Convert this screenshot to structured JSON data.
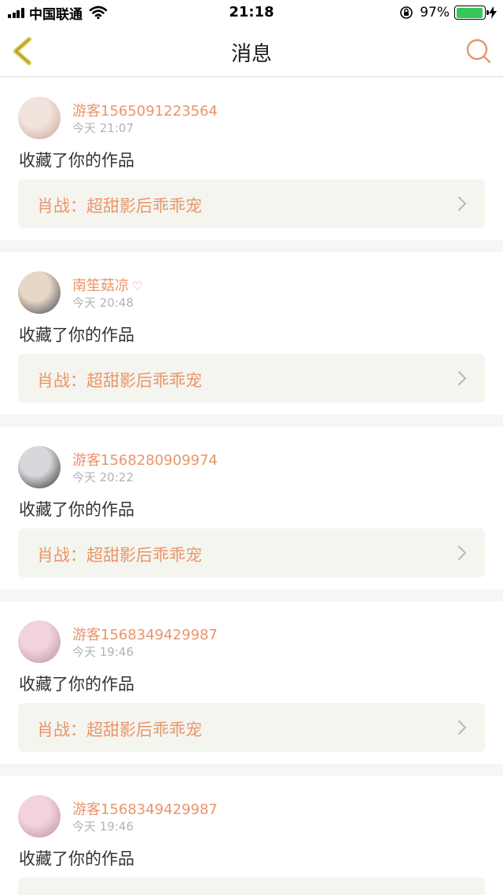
{
  "status_bar": {
    "carrier": "中国联通",
    "time": "21:18",
    "battery": "97%",
    "battery_level": 0.97
  },
  "nav": {
    "title": "消息",
    "back_icon": "chevron-left-icon",
    "search_icon": "search-icon"
  },
  "notifications": [
    {
      "username": "游客1565091223564",
      "time": "今天 21:07",
      "action": "收藏了你的作品",
      "work_title": "肖战：超甜影后乖乖宠",
      "has_heart": false,
      "avatar_colors": [
        "#f1e4dc",
        "#c9a39a"
      ]
    },
    {
      "username": "南笙菇凉",
      "time": "今天 20:48",
      "action": "收藏了你的作品",
      "work_title": "肖战：超甜影后乖乖宠",
      "has_heart": true,
      "avatar_colors": [
        "#e8d6c6",
        "#3a3f4a"
      ]
    },
    {
      "username": "游客1568280909974",
      "time": "今天 20:22",
      "action": "收藏了你的作品",
      "work_title": "肖战：超甜影后乖乖宠",
      "has_heart": false,
      "avatar_colors": [
        "#d8d8dc",
        "#2e2a2c"
      ]
    },
    {
      "username": "游客1568349429987",
      "time": "今天 19:46",
      "action": "收藏了你的作品",
      "work_title": "肖战：超甜影后乖乖宠",
      "has_heart": false,
      "avatar_colors": [
        "#f2d2dc",
        "#b98fa4"
      ]
    },
    {
      "username": "游客1568349429987",
      "time": "今天 19:46",
      "action": "收藏了你的作品",
      "work_title": "",
      "has_heart": false,
      "avatar_colors": [
        "#f2d2dc",
        "#b98fa4"
      ]
    }
  ],
  "icons": {
    "heart": "heart-icon",
    "chevron": "chevron-right-icon"
  },
  "colors": {
    "accent": "#e9956a",
    "back_icon": "#e0c94a",
    "battery": "#35c759"
  }
}
